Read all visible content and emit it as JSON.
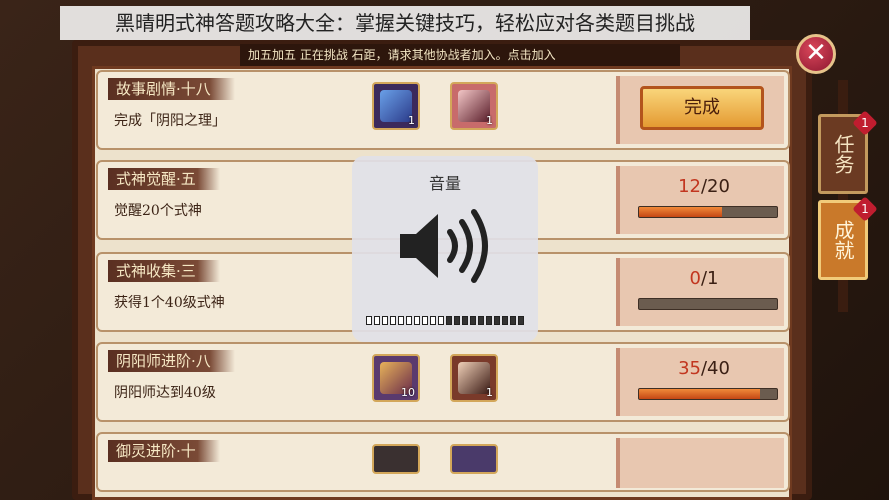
{
  "overlay_title": "黑晴明式神答题攻略大全：掌握关键技巧，轻松应对各类题目挑战",
  "banner": "加五加五 正在挑战 石距，请求其他协战者加入。点击加入",
  "close_glyph": "✕",
  "side_tabs": [
    {
      "label": "任务",
      "badge": "1",
      "active": false
    },
    {
      "label": "成就",
      "badge": "1",
      "active": true
    }
  ],
  "volume": {
    "label": "音量",
    "level_segments": 10,
    "total_segments": 20
  },
  "tasks": [
    {
      "title": "故事剧情·十八",
      "desc": "完成「阴阳之理」",
      "rewards": [
        {
          "icon": "scroll-item-icon",
          "count": "1"
        },
        {
          "icon": "shikigami-portrait-icon",
          "count": "1"
        }
      ],
      "status": "complete",
      "complete_label": "完成"
    },
    {
      "title": "式神觉醒·五",
      "desc": "觉醒20个式神",
      "rewards": [],
      "status": "progress",
      "current": "12",
      "total": "/20",
      "progress": 0.6
    },
    {
      "title": "式神收集·三",
      "desc": "获得1个40级式神",
      "rewards": [],
      "status": "progress",
      "current": "0",
      "total": "/1",
      "progress": 0.0
    },
    {
      "title": "阴阳师进阶·八",
      "desc": "阴阳师达到40级",
      "rewards": [
        {
          "icon": "summon-ticket-icon",
          "count": "10"
        },
        {
          "icon": "shikigami-portrait-icon",
          "count": "1"
        }
      ],
      "status": "progress",
      "current": "35",
      "total": "/40",
      "progress": 0.875
    },
    {
      "title": "御灵进阶·十",
      "desc": "",
      "rewards": [],
      "status": "progress",
      "current": "",
      "total": "",
      "progress": 0.0
    }
  ],
  "colors": {
    "accent": "#c2361f",
    "frame": "#5a2f1c",
    "paper": "#ede2cc",
    "bar_fill": "#e36a2a"
  }
}
